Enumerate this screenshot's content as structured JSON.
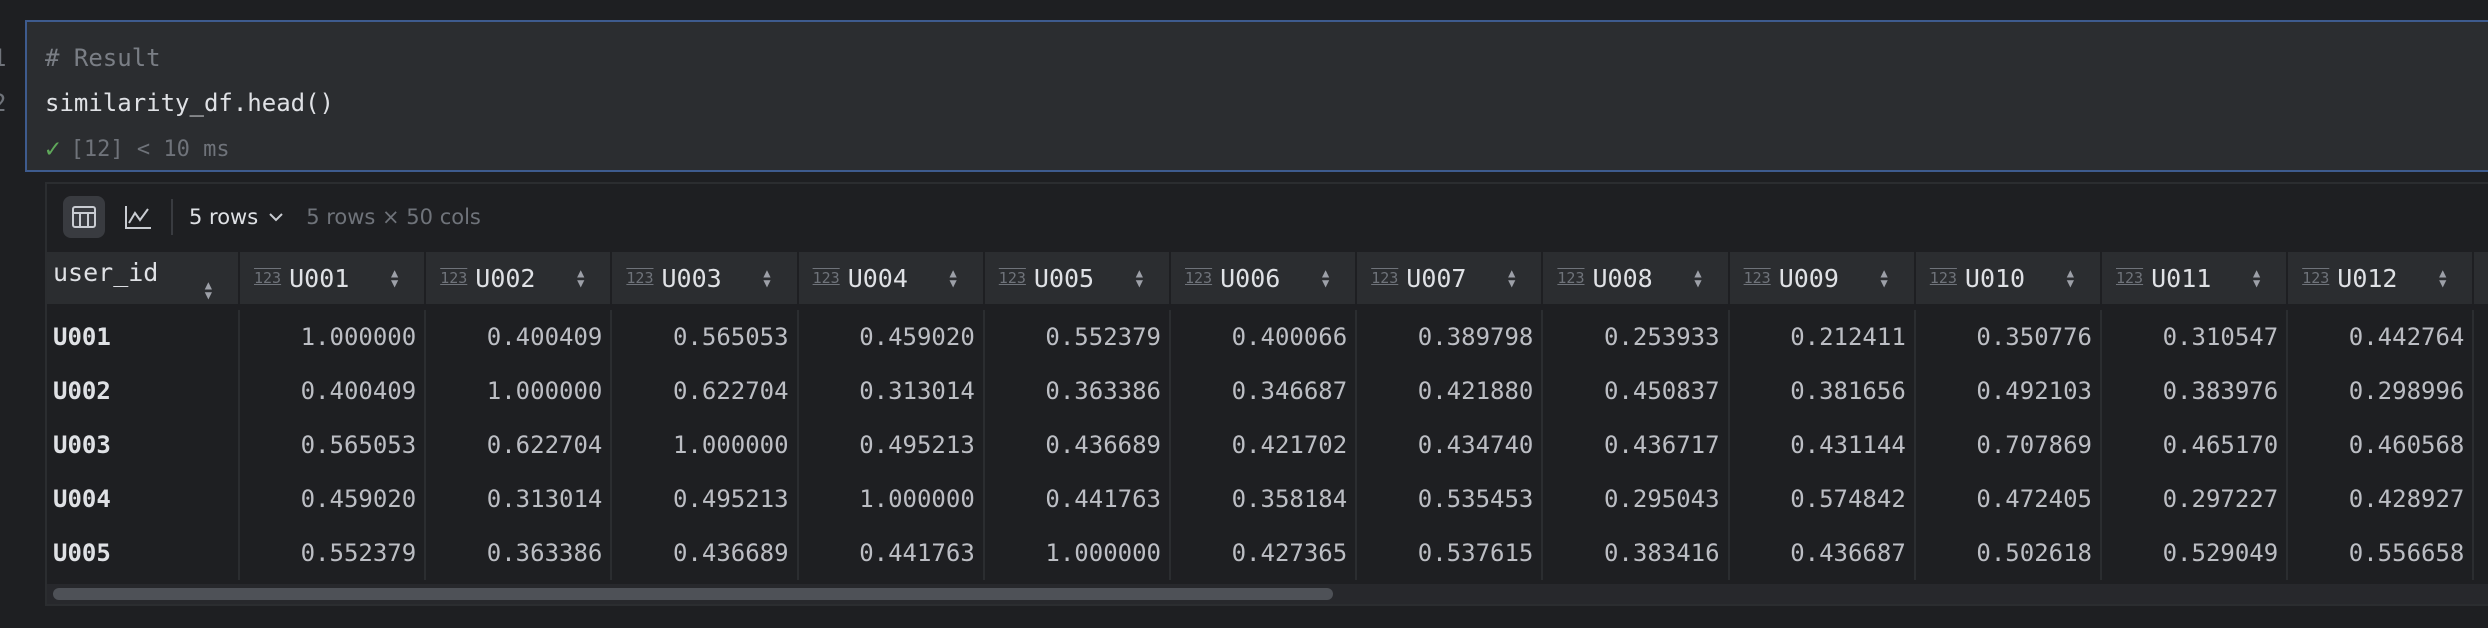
{
  "editor": {
    "line_numbers": [
      "1",
      "2"
    ],
    "code_lines": [
      "# Result",
      "similarity_df.head()"
    ],
    "status": {
      "icon": "check-icon",
      "text": "[12] < 10 ms",
      "color": "#5fa85a"
    }
  },
  "output": {
    "toolbar": {
      "table_view_icon": "table-icon",
      "chart_view_icon": "line-chart-icon",
      "rows_selector": "5 rows",
      "shape": "5 rows × 50 cols"
    },
    "table": {
      "index_header": "user_id",
      "type_badge": "123",
      "columns": [
        "U001",
        "U002",
        "U003",
        "U004",
        "U005",
        "U006",
        "U007",
        "U008",
        "U009",
        "U010",
        "U011",
        "U012"
      ],
      "rows": [
        {
          "id": "U001",
          "values": [
            "1.000000",
            "0.400409",
            "0.565053",
            "0.459020",
            "0.552379",
            "0.400066",
            "0.389798",
            "0.253933",
            "0.212411",
            "0.350776",
            "0.310547",
            "0.442764"
          ]
        },
        {
          "id": "U002",
          "values": [
            "0.400409",
            "1.000000",
            "0.622704",
            "0.313014",
            "0.363386",
            "0.346687",
            "0.421880",
            "0.450837",
            "0.381656",
            "0.492103",
            "0.383976",
            "0.298996"
          ]
        },
        {
          "id": "U003",
          "values": [
            "0.565053",
            "0.622704",
            "1.000000",
            "0.495213",
            "0.436689",
            "0.421702",
            "0.434740",
            "0.436717",
            "0.431144",
            "0.707869",
            "0.465170",
            "0.460568"
          ]
        },
        {
          "id": "U004",
          "values": [
            "0.459020",
            "0.313014",
            "0.495213",
            "1.000000",
            "0.441763",
            "0.358184",
            "0.535453",
            "0.295043",
            "0.574842",
            "0.472405",
            "0.297227",
            "0.428927"
          ]
        },
        {
          "id": "U005",
          "values": [
            "0.552379",
            "0.363386",
            "0.436689",
            "0.441763",
            "1.000000",
            "0.427365",
            "0.537615",
            "0.383416",
            "0.436687",
            "0.502618",
            "0.529049",
            "0.556658"
          ]
        }
      ]
    }
  }
}
